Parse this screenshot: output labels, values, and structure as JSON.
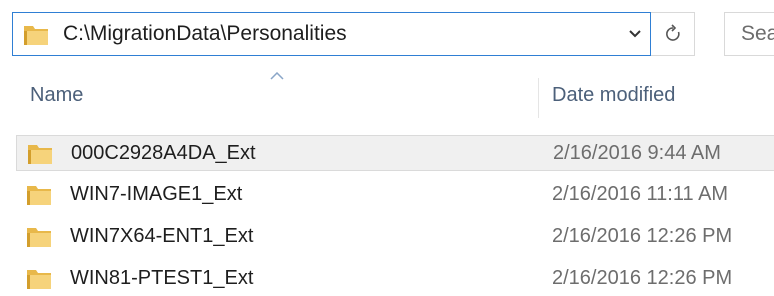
{
  "address_bar": {
    "path": "C:\\MigrationData\\Personalities"
  },
  "search": {
    "placeholder": "Sea"
  },
  "columns": {
    "name": "Name",
    "date_modified": "Date modified"
  },
  "files": [
    {
      "name": "000C2928A4DA_Ext",
      "date": "2/16/2016 9:44 AM",
      "selected": true
    },
    {
      "name": "WIN7-IMAGE1_Ext",
      "date": "2/16/2016 11:11 AM",
      "selected": false
    },
    {
      "name": "WIN7X64-ENT1_Ext",
      "date": "2/16/2016 12:26 PM",
      "selected": false
    },
    {
      "name": "WIN81-PTEST1_Ext",
      "date": "2/16/2016 12:26 PM",
      "selected": false
    }
  ],
  "colors": {
    "address_border": "#2f7fd4",
    "folder_yellow": "#e8b84a",
    "selection": "#f0f0f0",
    "header_text": "#4c607a"
  }
}
